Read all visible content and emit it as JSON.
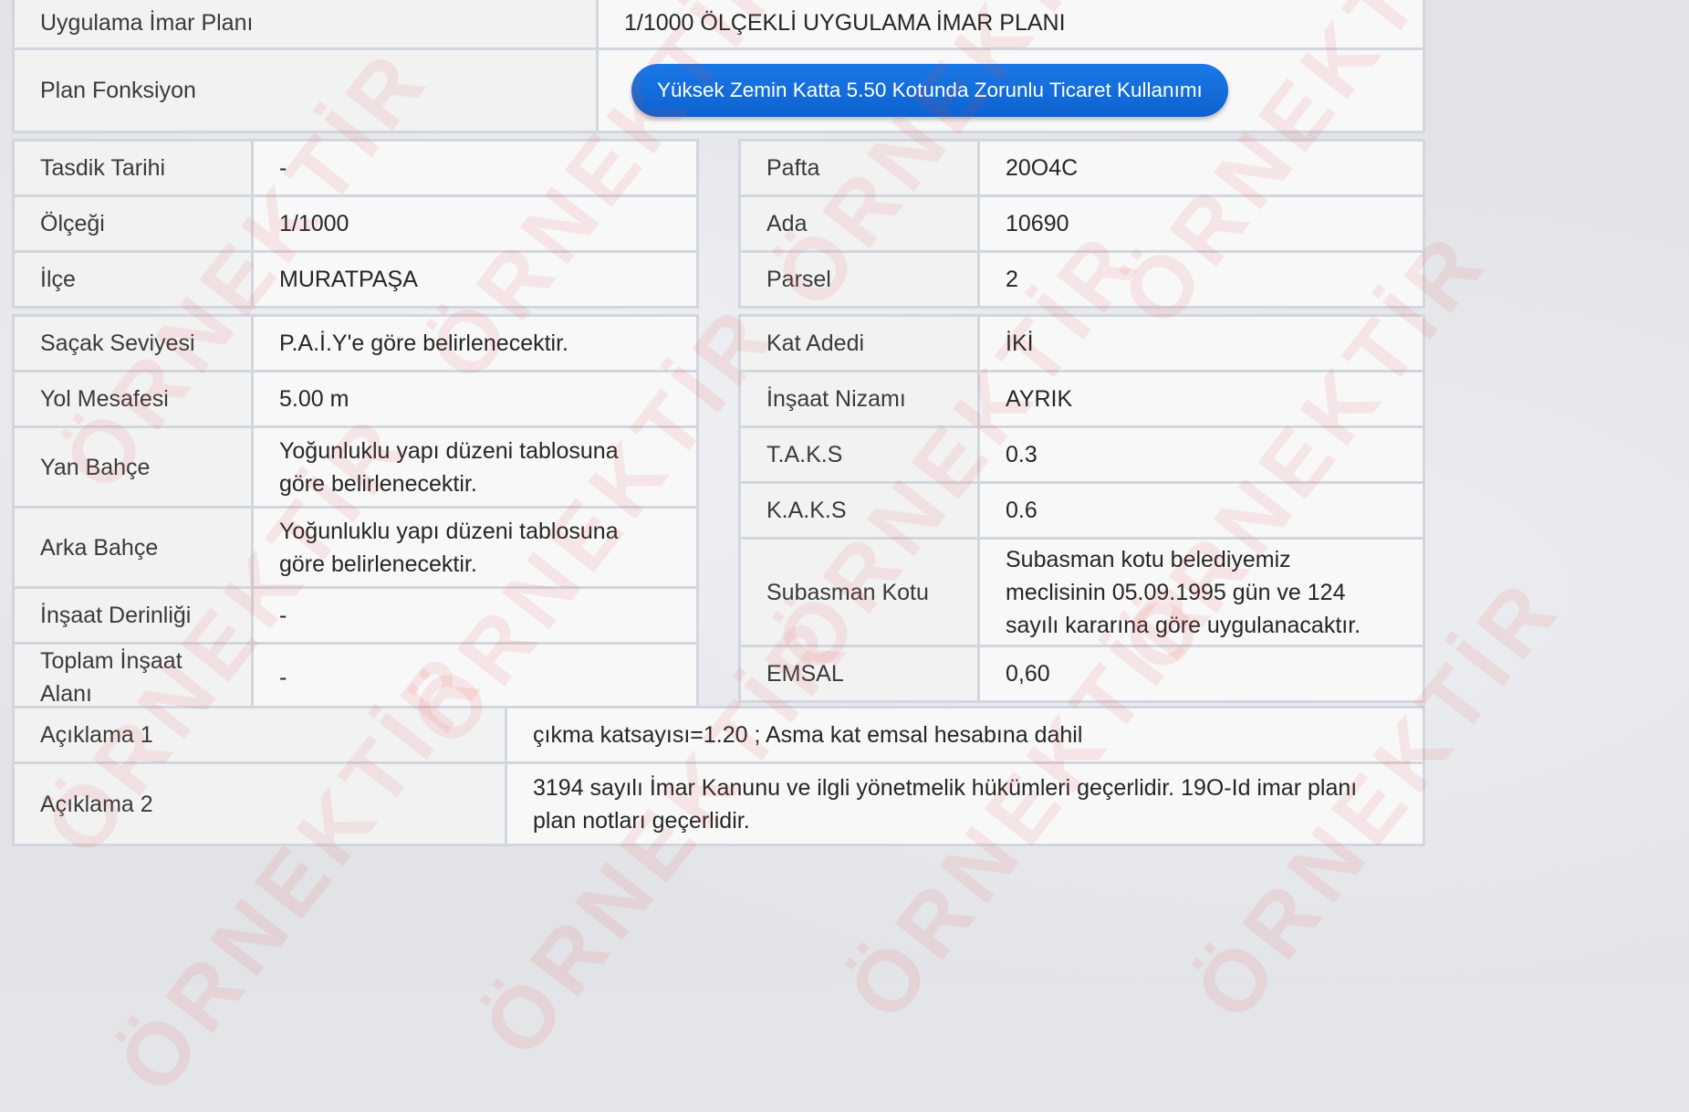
{
  "top": {
    "plan_label": "Uygulama İmar Planı",
    "plan_value": "1/1000 ÖLÇEKLİ UYGULAMA İMAR PLANI",
    "function_label": "Plan Fonksiyon",
    "function_value": "Yüksek Zemin Katta 5.50 Kotunda Zorunlu Ticaret Kullanımı"
  },
  "info_left": [
    {
      "label": "Tasdik Tarihi",
      "value": "-"
    },
    {
      "label": "Ölçeği",
      "value": "1/1000"
    },
    {
      "label": "İlçe",
      "value": "MURATPAŞA"
    }
  ],
  "info_right": [
    {
      "label": "Pafta",
      "value": "20O4C"
    },
    {
      "label": "Ada",
      "value": "10690"
    },
    {
      "label": "Parsel",
      "value": "2"
    }
  ],
  "details_left": [
    {
      "label": "Saçak Seviyesi",
      "value": "P.A.İ.Y'e göre belirlenecektir."
    },
    {
      "label": "Yol Mesafesi",
      "value": "5.00 m"
    },
    {
      "label": "Yan Bahçe",
      "value": "Yoğunluklu yapı düzeni tablosuna göre belirlenecektir."
    },
    {
      "label": "Arka Bahçe",
      "value": "Yoğunluklu yapı düzeni tablosuna göre belirlenecektir."
    },
    {
      "label": "İnşaat Derinliği",
      "value": "-"
    },
    {
      "label": "Toplam İnşaat Alanı",
      "value": "-"
    }
  ],
  "details_right": [
    {
      "label": "Kat Adedi",
      "value": "İKİ"
    },
    {
      "label": "İnşaat Nizamı",
      "value": "AYRIK"
    },
    {
      "label": "T.A.K.S",
      "value": "0.3"
    },
    {
      "label": "K.A.K.S",
      "value": "0.6"
    },
    {
      "label": "Subasman Kotu",
      "value": "Subasman kotu belediyemiz meclisinin 05.09.1995 gün ve 124 sayılı kararına göre uygulanacaktır."
    },
    {
      "label": "EMSAL",
      "value": "0,60"
    }
  ],
  "notes": [
    {
      "label": "Açıklama 1",
      "value": "çıkma katsayısı=1.20 ; Asma kat emsal hesabına dahil"
    },
    {
      "label": "Açıklama 2",
      "value": "3194 sayılı İmar Kanunu ve ilgli yönetmelik hükümleri geçerlidir. 19O-Id imar planı plan notları geçerlidir."
    }
  ],
  "watermark": "ÖRNEKTİR"
}
